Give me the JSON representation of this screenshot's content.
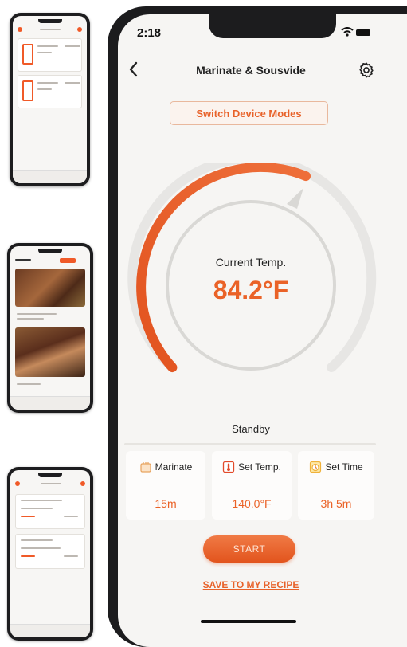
{
  "status": {
    "time": "2:18"
  },
  "header": {
    "title": "Marinate & Sousvide"
  },
  "mode_button": {
    "label": "Switch Device Modes"
  },
  "gauge": {
    "label": "Current Temp.",
    "value": "84.2°F",
    "accent": "#ea6227"
  },
  "state": {
    "label": "Standby"
  },
  "settings": [
    {
      "label": "Marinate",
      "value": "15m",
      "icon": "marinate-icon"
    },
    {
      "label": "Set Temp.",
      "value": "140.0°F",
      "icon": "thermometer-icon"
    },
    {
      "label": "Set Time",
      "value": "3h 5m",
      "icon": "timer-icon"
    }
  ],
  "actions": {
    "start_label": "START",
    "save_label": "SAVE TO MY RECIPE"
  }
}
